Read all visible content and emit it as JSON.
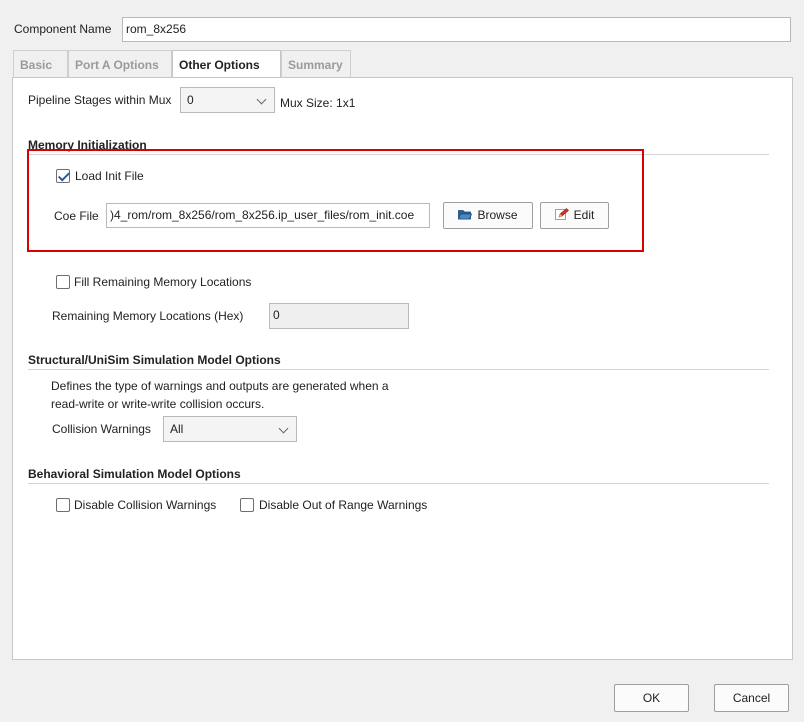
{
  "component": {
    "label": "Component Name",
    "value": "rom_8x256"
  },
  "tabs": [
    {
      "label": "Basic",
      "active": false
    },
    {
      "label": "Port A Options",
      "active": false
    },
    {
      "label": "Other Options",
      "active": true
    },
    {
      "label": "Summary",
      "active": false
    }
  ],
  "pipeline": {
    "label": "Pipeline Stages within Mux",
    "value": "0",
    "mux_size": "Mux Size: 1x1"
  },
  "memory_init": {
    "title": "Memory Initialization",
    "load_init_label": "Load Init File",
    "load_init_checked": true,
    "coe_label": "Coe File",
    "coe_value": ")4_rom/rom_8x256/rom_8x256.ip_user_files/rom_init.coe",
    "browse_label": "Browse",
    "edit_label": "Edit"
  },
  "fill": {
    "label": "Fill Remaining Memory Locations",
    "checked": false,
    "remaining_label": "Remaining Memory Locations (Hex)",
    "remaining_value": "0"
  },
  "structural": {
    "title": "Structural/UniSim Simulation Model Options",
    "desc_line1": "Defines the type of warnings and outputs are generated when a",
    "desc_line2": "read-write or write-write collision occurs.",
    "collision_label": "Collision Warnings",
    "collision_value": "All"
  },
  "behavioral": {
    "title": "Behavioral Simulation Model Options",
    "disable_collision_label": "Disable Collision Warnings",
    "disable_collision_checked": false,
    "disable_range_label": "Disable Out of Range Warnings",
    "disable_range_checked": false
  },
  "footer": {
    "ok_label": "OK",
    "cancel_label": "Cancel"
  },
  "colors": {
    "highlight": "#d90000",
    "accent": "#2a5c9c"
  }
}
